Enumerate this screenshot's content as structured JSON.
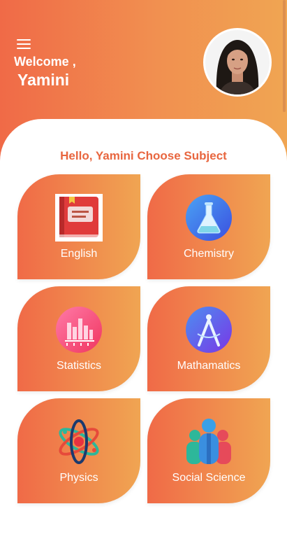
{
  "header": {
    "welcome": "Welcome ,",
    "user_name": "Yamini"
  },
  "greeting": "Hello, Yamini Choose Subject",
  "subjects": [
    {
      "label": "English",
      "icon": "book-icon"
    },
    {
      "label": "Chemistry",
      "icon": "flask-icon"
    },
    {
      "label": "Statistics",
      "icon": "bar-chart-icon"
    },
    {
      "label": "Mathamatics",
      "icon": "compass-icon"
    },
    {
      "label": "Physics",
      "icon": "atom-icon"
    },
    {
      "label": "Social Science",
      "icon": "people-icon"
    }
  ],
  "colors": {
    "accent": "#e8663f",
    "gradient_start": "#f06a47",
    "gradient_end": "#f0a552"
  }
}
